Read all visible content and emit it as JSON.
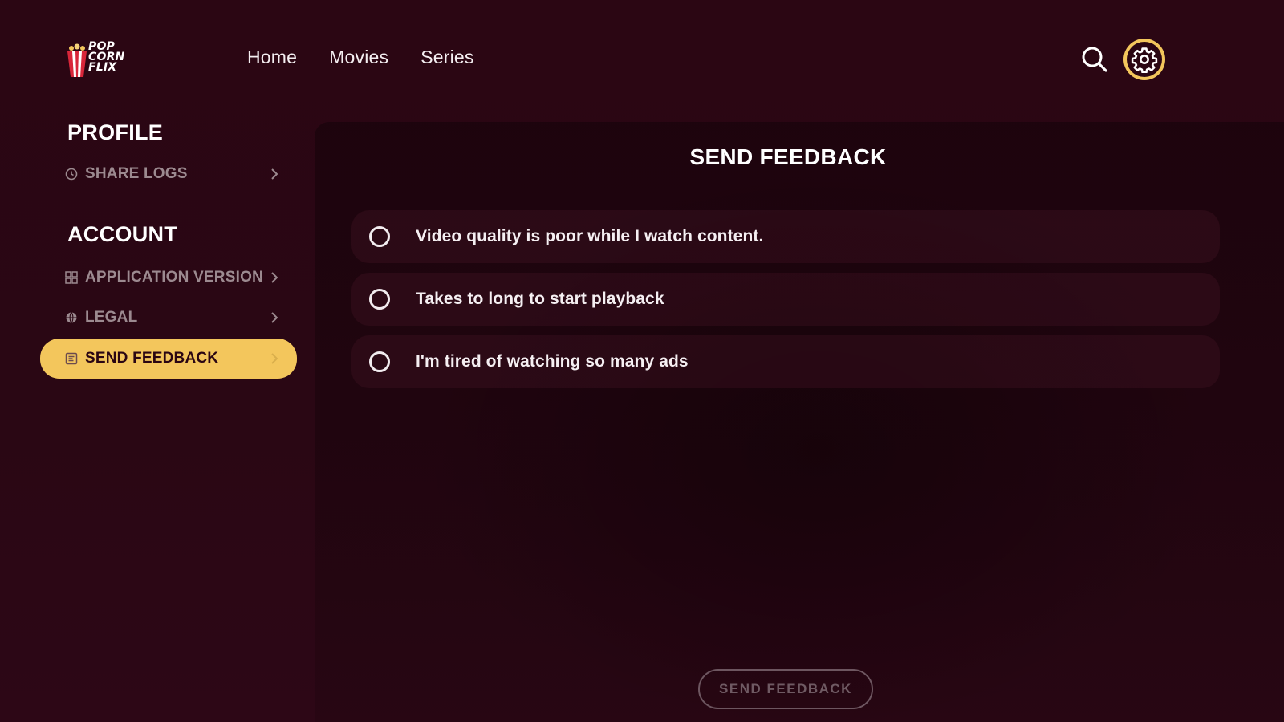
{
  "app": {
    "logo_text_lines": [
      "POP",
      "CORN",
      "FLIX"
    ],
    "logo_icon": "popcorn-icon"
  },
  "nav": {
    "items": [
      {
        "label": "Home"
      },
      {
        "label": "Movies"
      },
      {
        "label": "Series"
      }
    ]
  },
  "top_actions": {
    "search_icon": "search-icon",
    "settings_icon": "gear-icon",
    "settings_active": true,
    "accent_color": "#f3c65c"
  },
  "sidebar": {
    "profile_title": "PROFILE",
    "profile_items": [
      {
        "label": "SHARE LOGS",
        "icon": "clock-icon"
      }
    ],
    "account_title": "ACCOUNT",
    "account_items": [
      {
        "label": "APPLICATION VERSION",
        "icon": "grid-icon"
      },
      {
        "label": "LEGAL",
        "icon": "globe-icon"
      },
      {
        "label": "SEND FEEDBACK",
        "icon": "feedback-icon",
        "selected": true
      }
    ]
  },
  "main": {
    "title": "SEND FEEDBACK",
    "options": [
      {
        "label": "Video quality is poor while I watch content.",
        "checked": false
      },
      {
        "label": "Takes to long to start playback",
        "checked": false
      },
      {
        "label": "I'm tired of watching so many ads",
        "checked": false
      }
    ],
    "submit_label": "SEND FEEDBACK",
    "submit_enabled": false
  },
  "colors": {
    "background": "#2a0613",
    "accent": "#f3c65c",
    "text": "#f2ecef",
    "muted": "#9c8a90"
  }
}
